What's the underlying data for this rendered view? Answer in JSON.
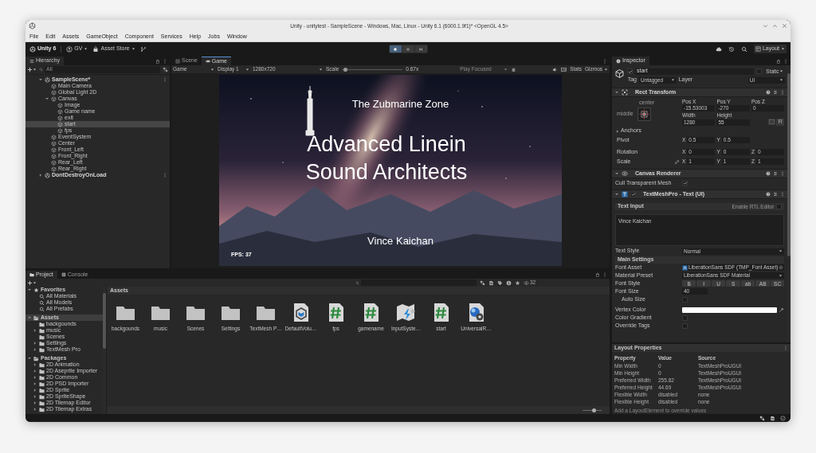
{
  "window": {
    "title": "Unity - unitytest - SampleScene - Windows, Mac, Linux - Unity 6.1 (6000.1.9f1)* <OpenGL 4.5>"
  },
  "menu": [
    "File",
    "Edit",
    "Assets",
    "GameObject",
    "Component",
    "Services",
    "Help",
    "Jobs",
    "Window"
  ],
  "toolbar": {
    "account": "Unity 6",
    "user": "GV",
    "store": "Asset Store",
    "layout": "Layout",
    "play_controls": [
      {
        "kind": "play",
        "on": true
      },
      {
        "kind": "pause",
        "on": false
      },
      {
        "kind": "step",
        "on": false
      }
    ]
  },
  "hierarchy": {
    "tab": "Hierarchy",
    "search": {
      "placeholder": "All"
    },
    "items": [
      {
        "label": "SampleScene*",
        "kind": "scene",
        "expanded": true,
        "selected": false,
        "children": [
          {
            "label": "Main Camera",
            "kind": "object",
            "selected": false
          },
          {
            "label": "Global Light 2D",
            "kind": "object",
            "selected": false
          },
          {
            "label": "Canvas",
            "kind": "object",
            "expanded": true,
            "selected": false,
            "children": [
              {
                "label": "Image",
                "kind": "object",
                "selected": false
              },
              {
                "label": "Game name",
                "kind": "object",
                "selected": false
              },
              {
                "label": "exit",
                "kind": "object",
                "selected": false
              },
              {
                "label": "start",
                "kind": "object",
                "selected": true
              },
              {
                "label": "fps",
                "kind": "object",
                "selected": false
              }
            ]
          },
          {
            "label": "EventSystem",
            "kind": "object",
            "selected": false
          },
          {
            "label": "Center",
            "kind": "object",
            "selected": false
          },
          {
            "label": "Front_Left",
            "kind": "object",
            "selected": false
          },
          {
            "label": "Front_Right",
            "kind": "object",
            "selected": false
          },
          {
            "label": "Rear_Left",
            "kind": "object",
            "selected": false
          },
          {
            "label": "Rear_Right",
            "kind": "object",
            "selected": false
          }
        ]
      },
      {
        "label": "DontDestroyOnLoad",
        "kind": "scene",
        "expanded": false,
        "selected": false
      }
    ]
  },
  "game": {
    "tabs": [
      {
        "label": "Scene",
        "selected": false
      },
      {
        "label": "Game",
        "selected": true
      }
    ],
    "view": "Game",
    "display": "Display 1",
    "resolution": "1280x720",
    "scale": {
      "label": "Scale",
      "level": 0.05,
      "reading": "0.67x"
    },
    "play_mode": {
      "label": "Play Focused",
      "disabled": true
    },
    "stats": "Stats",
    "gizmos": "Gizmos",
    "screen": {
      "subtitle": "The Zubmarine Zone",
      "title": "Advanced Linein Sound Architects",
      "author": "Vince Kaichan",
      "fps": "FPS: 37"
    }
  },
  "project": {
    "tabs": [
      {
        "label": "Project",
        "selected": true
      },
      {
        "label": "Console",
        "selected": false
      }
    ],
    "count": "32",
    "tree": [
      {
        "label": "Favorites",
        "kind": "favorites",
        "expanded": true,
        "selected": false,
        "children": [
          {
            "label": "All Materials",
            "kind": "search",
            "selected": false
          },
          {
            "label": "All Models",
            "kind": "search",
            "selected": false
          },
          {
            "label": "All Prefabs",
            "kind": "search",
            "selected": false
          }
        ]
      },
      {
        "label": "Assets",
        "kind": "root",
        "expanded": true,
        "selected": true,
        "children": [
          {
            "label": "backgounds",
            "kind": "folder",
            "selected": false
          },
          {
            "label": "music",
            "kind": "folder",
            "expanded": false,
            "selected": false
          },
          {
            "label": "Scenes",
            "kind": "folder",
            "selected": false
          },
          {
            "label": "Settings",
            "kind": "folder",
            "expanded": false,
            "selected": false
          },
          {
            "label": "TextMesh Pro",
            "kind": "folder",
            "expanded": false,
            "selected": false
          }
        ]
      },
      {
        "label": "Packages",
        "kind": "root",
        "expanded": true,
        "selected": false,
        "children": [
          {
            "label": "2D Animation",
            "kind": "folder",
            "expanded": false,
            "selected": false
          },
          {
            "label": "2D Aseprite Importer",
            "kind": "folder",
            "expanded": false,
            "selected": false
          },
          {
            "label": "2D Common",
            "kind": "folder",
            "expanded": false,
            "selected": false
          },
          {
            "label": "2D PSD Importer",
            "kind": "folder",
            "expanded": false,
            "selected": false
          },
          {
            "label": "2D Sprite",
            "kind": "folder",
            "expanded": false,
            "selected": false
          },
          {
            "label": "2D SpriteShape",
            "kind": "folder",
            "expanded": false,
            "selected": false
          },
          {
            "label": "2D Tilemap Editor",
            "kind": "folder",
            "expanded": false,
            "selected": false
          },
          {
            "label": "2D Tilemap Extras",
            "kind": "folder",
            "expanded": false,
            "selected": false
          }
        ]
      }
    ],
    "breadcrumb": "Assets",
    "assets": [
      {
        "label": "backgounds",
        "kind": "folder"
      },
      {
        "label": "music",
        "kind": "folder"
      },
      {
        "label": "Scenes",
        "kind": "folder"
      },
      {
        "label": "Settings",
        "kind": "folder"
      },
      {
        "label": "TextMesh P…",
        "kind": "folder"
      },
      {
        "label": "DefaultVolu…",
        "kind": "volume"
      },
      {
        "label": "fps",
        "kind": "script"
      },
      {
        "label": "gamename",
        "kind": "script"
      },
      {
        "label": "InputSyste…",
        "kind": "input"
      },
      {
        "label": "start",
        "kind": "script"
      },
      {
        "label": "UniversalR…",
        "kind": "pipeline"
      }
    ],
    "icon_size": {
      "level": 0.6
    }
  },
  "inspector": {
    "tab": "Inspector",
    "object": {
      "active": true,
      "name": "start",
      "static_label": "Static",
      "static": false,
      "tag_label": "Tag",
      "tag": "Untagged",
      "layer_label": "Layer",
      "layer": "UI"
    },
    "rect_transform": {
      "title": "Rect Transform",
      "expanded": true,
      "anchor_h": "center",
      "anchor_v": "middle",
      "fields": [
        {
          "label": "Pos X",
          "value": "-15.53003"
        },
        {
          "label": "Pos Y",
          "value": "-270"
        },
        {
          "label": "Pos Z",
          "value": "0"
        },
        {
          "label": "Width",
          "value": "1280"
        },
        {
          "label": "Height",
          "value": "55"
        }
      ],
      "reset": "R",
      "anchors": {
        "label": "Anchors",
        "expanded": false
      },
      "rows": [
        {
          "label": "Pivot",
          "fields": [
            {
              "axis": "X",
              "value": "0.5"
            },
            {
              "axis": "Y",
              "value": "0.5"
            }
          ]
        },
        {
          "label": "Rotation",
          "fields": [
            {
              "axis": "X",
              "value": "0"
            },
            {
              "axis": "Y",
              "value": "0"
            },
            {
              "axis": "Z",
              "value": "0"
            }
          ]
        },
        {
          "label": "Scale",
          "linked": false,
          "fields": [
            {
              "axis": "X",
              "value": "1"
            },
            {
              "axis": "Y",
              "value": "1"
            },
            {
              "axis": "Z",
              "value": "1"
            }
          ]
        }
      ]
    },
    "canvas_renderer": {
      "title": "Canvas Renderer",
      "expanded": true,
      "cull_label": "Cull Transparent Mesh",
      "cull": true
    },
    "text_component": {
      "title": "TextMeshPro - Text (UI)",
      "expanded": true,
      "enabled": true,
      "text_input": "Text Input",
      "rtl_label": "Enable RTL Editor",
      "rtl": false,
      "text": "Vince Kaichan",
      "text_style_label": "Text Style",
      "text_style": "Normal",
      "main_settings": "Main Settings",
      "rows": [
        {
          "kind": "object",
          "label": "Font Asset",
          "value": "LiberationSans SDF (TMP_Font Asset)"
        },
        {
          "kind": "dropdown",
          "label": "Material Preset",
          "value": "LiberationSans SDF Material"
        },
        {
          "kind": "buttons",
          "label": "Font Style",
          "options": [
            {
              "label": "B",
              "selected": false
            },
            {
              "label": "I",
              "selected": false
            },
            {
              "label": "U",
              "selected": false
            },
            {
              "label": "S",
              "selected": false
            },
            {
              "label": "ab",
              "selected": false
            },
            {
              "label": "AB",
              "selected": false
            },
            {
              "label": "SC",
              "selected": false
            }
          ]
        },
        {
          "kind": "number",
          "label": "Font Size",
          "value": "40"
        },
        {
          "kind": "subcheckbox",
          "label": "Auto Size",
          "checked": false
        },
        {
          "kind": "color",
          "label": "Vertex Color"
        },
        {
          "kind": "checkbox",
          "label": "Color Gradient",
          "checked": false
        },
        {
          "kind": "checkbox",
          "label": "Override Tags",
          "checked": false
        }
      ]
    },
    "layout_properties": {
      "title": "Layout Properties",
      "columns": [
        "Property",
        "Value",
        "Source"
      ],
      "rows": [
        [
          "Min Width",
          "0",
          "TextMeshProUGUI"
        ],
        [
          "Min Height",
          "0",
          "TextMeshProUGUI"
        ],
        [
          "Preferred Width",
          "255.82",
          "TextMeshProUGUI"
        ],
        [
          "Preferred Height",
          "44.69",
          "TextMeshProUGUI"
        ],
        [
          "Flexible Width",
          "disabled",
          "none"
        ],
        [
          "Flexible Height",
          "disabled",
          "none"
        ]
      ],
      "note": "Add a LayoutElement to override values"
    }
  }
}
